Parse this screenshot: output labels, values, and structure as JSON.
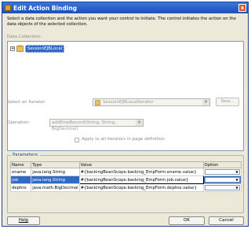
{
  "window": {
    "title": "Edit Action Binding",
    "close_glyph": "x"
  },
  "instructions": "Select a data collection and the action you want your control to initiate. The control initiates the action on the data objects of the selected collection.",
  "data_collection": {
    "label": "Data Collection:",
    "tree": {
      "expander": "+",
      "item": "SessionEJBLocal"
    }
  },
  "iterator": {
    "label": "Select an Iterator:",
    "value": "SessionEJBLocalIterator",
    "new_button": "New..."
  },
  "operation": {
    "label": "Operation:",
    "value": "addEmpRecord(String, String, BigDecimal)"
  },
  "apply_all": {
    "label": "Apply to all iterators in page definition"
  },
  "parameters": {
    "legend": "Parameters:",
    "columns": [
      "Name",
      "Type",
      "Value",
      "Option"
    ],
    "rows": [
      {
        "name": "ename",
        "type": "java.lang.String",
        "value": "#{backingBeanScope.backing_EmpForm.ename.value}"
      },
      {
        "name": "job",
        "type": "java.lang.String",
        "value": "#{backingBeanScope.backing_EmpForm.job.value}"
      },
      {
        "name": "deptno",
        "type": "java.math.BigDecimal",
        "value": "#{backingBeanScope.backing_EmpForm.deptno.value}"
      }
    ]
  },
  "buttons": {
    "help": "Help",
    "ok": "OK",
    "cancel": "Cancel"
  }
}
